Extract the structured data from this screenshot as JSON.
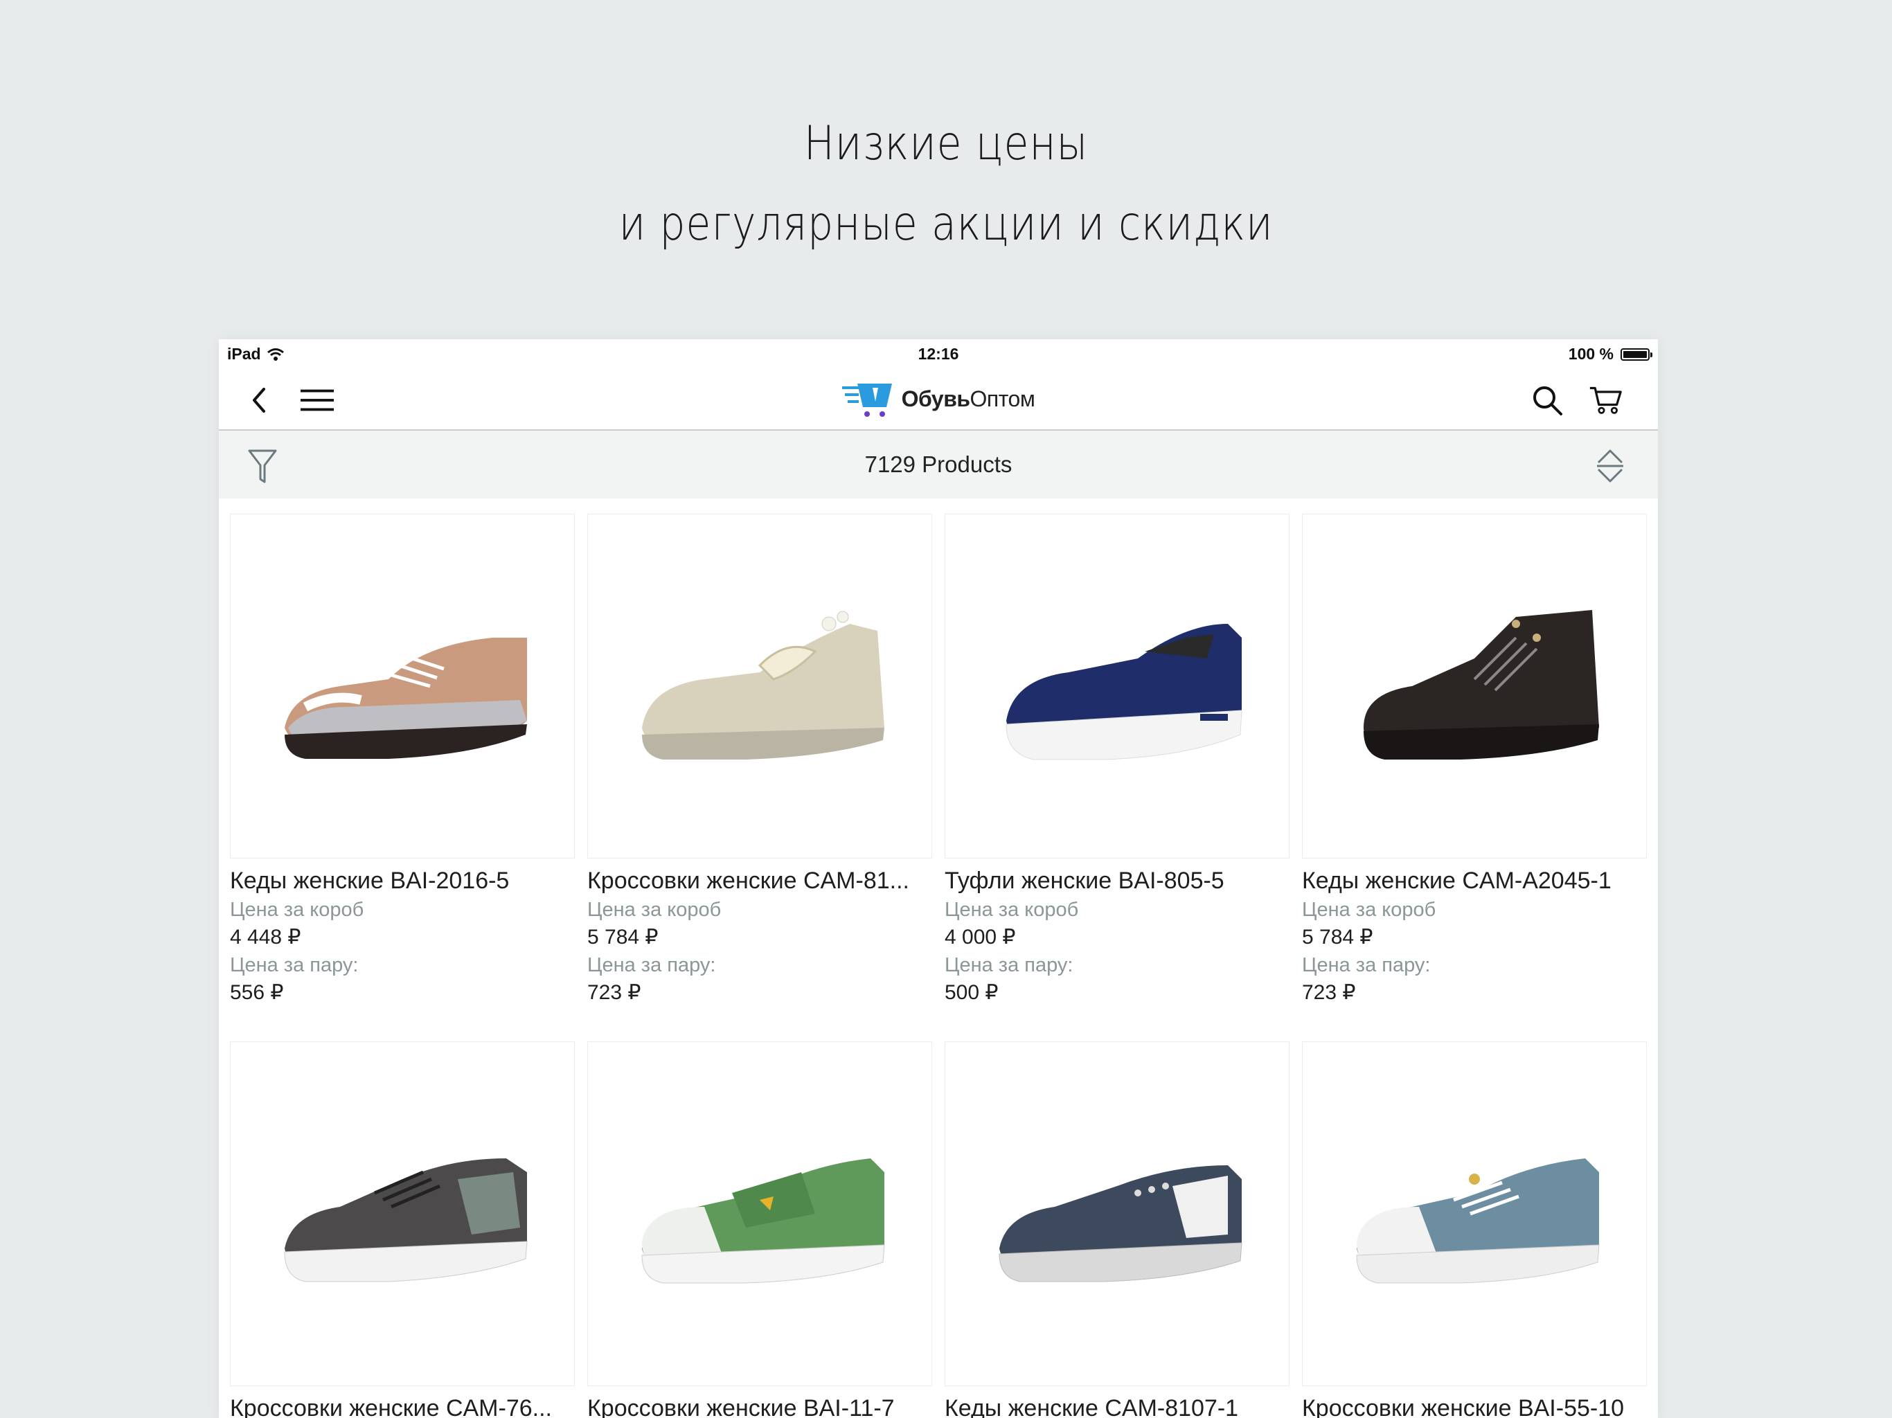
{
  "headline": {
    "line1": "Низкие цены",
    "line2": "и регулярные акции и скидки"
  },
  "statusbar": {
    "device": "iPad",
    "time": "12:16",
    "battery": "100 %"
  },
  "navbar": {
    "logo_bold": "Обувь",
    "logo_regular": "Оптом"
  },
  "filterbar": {
    "count": "7129 Products"
  },
  "products": [
    {
      "name": "Кеды женские BAI-2016-5",
      "box_label": "Цена за короб",
      "box_price": "4 448 ₽",
      "pair_label": "Цена за пару:",
      "pair_price": "556 ₽"
    },
    {
      "name": "Кроссовки женские CAM-81...",
      "box_label": "Цена за короб",
      "box_price": "5 784 ₽",
      "pair_label": "Цена за пару:",
      "pair_price": "723 ₽"
    },
    {
      "name": "Туфли женские BAI-805-5",
      "box_label": "Цена за короб",
      "box_price": "4 000 ₽",
      "pair_label": "Цена за пару:",
      "pair_price": "500 ₽"
    },
    {
      "name": "Кеды женские CAM-A2045-1",
      "box_label": "Цена за короб",
      "box_price": "5 784 ₽",
      "pair_label": "Цена за пару:",
      "pair_price": "723 ₽"
    },
    {
      "name": "Кроссовки женские CAM-76..."
    },
    {
      "name": "Кроссовки женские BAI-11-7"
    },
    {
      "name": "Кеды женские CAM-8107-1"
    },
    {
      "name": "Кроссовки женские BAI-55-10"
    }
  ],
  "colors": {
    "background": "#e7ebeb",
    "label_gray": "#8a9698",
    "logo_blue": "#2b9be0",
    "logo_purple": "#6a3fc8"
  },
  "icons": [
    "wifi-icon",
    "battery-icon",
    "back-chevron-icon",
    "menu-icon",
    "logo-cart-icon",
    "search-icon",
    "cart-icon",
    "filter-icon",
    "sort-icon",
    "shoe-image"
  ]
}
